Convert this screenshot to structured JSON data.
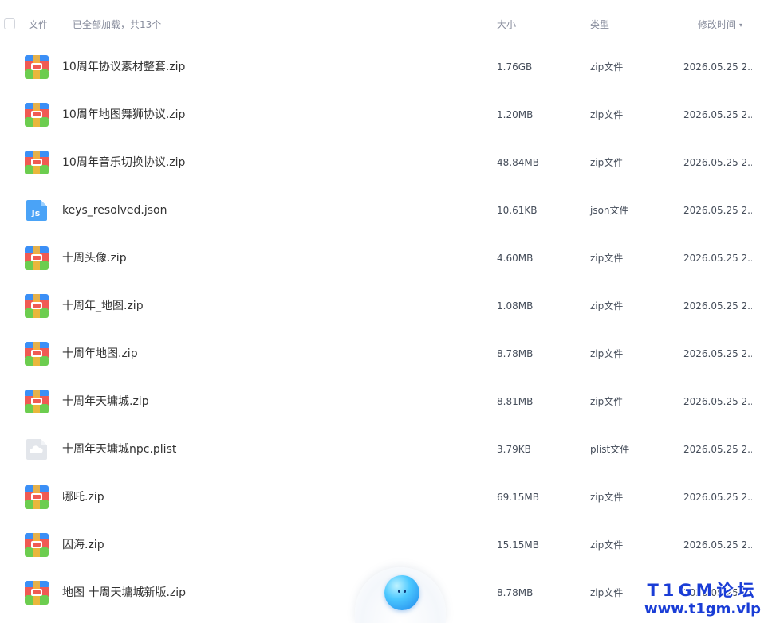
{
  "header": {
    "file_label": "文件",
    "loaded_label": "已全部加载，共13个",
    "size_label": "大小",
    "type_label": "类型",
    "mtime_label": "修改时间",
    "sort_icon": "sort-down-icon"
  },
  "files": [
    {
      "name": "10周年协议素材整套.zip",
      "size": "1.76GB",
      "type": "zip文件",
      "mtime": "2026.05.25 2...",
      "icon": "zip"
    },
    {
      "name": "10周年地图舞狮协议.zip",
      "size": "1.20MB",
      "type": "zip文件",
      "mtime": "2026.05.25 2...",
      "icon": "zip"
    },
    {
      "name": "10周年音乐切换协议.zip",
      "size": "48.84MB",
      "type": "zip文件",
      "mtime": "2026.05.25 2...",
      "icon": "zip"
    },
    {
      "name": "keys_resolved.json",
      "size": "10.61KB",
      "type": "json文件",
      "mtime": "2026.05.25 2...",
      "icon": "json"
    },
    {
      "name": "十周头像.zip",
      "size": "4.60MB",
      "type": "zip文件",
      "mtime": "2026.05.25 2...",
      "icon": "zip"
    },
    {
      "name": "十周年_地图.zip",
      "size": "1.08MB",
      "type": "zip文件",
      "mtime": "2026.05.25 2...",
      "icon": "zip"
    },
    {
      "name": "十周年地图.zip",
      "size": "8.78MB",
      "type": "zip文件",
      "mtime": "2026.05.25 2...",
      "icon": "zip"
    },
    {
      "name": "十周年天墉城.zip",
      "size": "8.81MB",
      "type": "zip文件",
      "mtime": "2026.05.25 2...",
      "icon": "zip"
    },
    {
      "name": "十周年天墉城npc.plist",
      "size": "3.79KB",
      "type": "plist文件",
      "mtime": "2026.05.25 2...",
      "icon": "cloud"
    },
    {
      "name": "哪吒.zip",
      "size": "69.15MB",
      "type": "zip文件",
      "mtime": "2026.05.25 2...",
      "icon": "zip"
    },
    {
      "name": "囚海.zip",
      "size": "15.15MB",
      "type": "zip文件",
      "mtime": "2026.05.25 2...",
      "icon": "zip"
    },
    {
      "name": "地图 十周天墉城新版.zip",
      "size": "8.78MB",
      "type": "zip文件",
      "mtime": "2026.05.25 2...",
      "icon": "zip"
    }
  ],
  "icons": {
    "zip": "zip-archive-icon",
    "json": "json-file-icon",
    "cloud": "cloud-file-icon"
  },
  "watermark": {
    "line1": "T1GM论坛",
    "line2": "www.t1gm.vip"
  },
  "colors": {
    "zip_blue": "#3b8ff6",
    "zip_red": "#f05a53",
    "zip_green": "#6ccd4f",
    "zip_orange": "#f7b53a",
    "json_blue": "#4aa3f7",
    "cloud_gray": "#d7dbe2",
    "watermark_blue": "#1a3dd6"
  }
}
